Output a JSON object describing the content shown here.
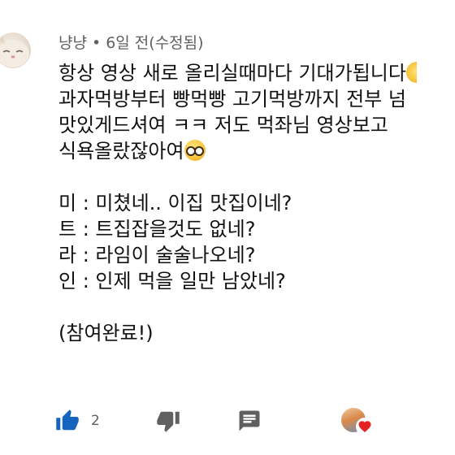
{
  "comment": {
    "author": "냥냥",
    "separator": "•",
    "time": "6일 전(수정됨)",
    "lines": [
      "항상 영상 새로 올리실때마다 기대가됩니다",
      "과자먹방부터 빵먹빵 고기먹방까지 전부 넘",
      "맛있게드셔여 ㅋㅋ 저도 먹좌님 영상보고",
      "식욕올랐잖아여",
      "",
      "미 : 미쳤네.. 이집 맛집이네?",
      "트 : 트집잡을것도 없네?",
      "라 : 라임이 술술나오네?",
      "인 : 인제 먹을 일만 남았네?",
      "",
      "(참여완료!)"
    ],
    "icons": {
      "line1_end": "smiling-face-emoji",
      "line4_end": "nerd-face-emoji"
    }
  },
  "actions": {
    "like_count": "2",
    "like_icon": "thumbs-up-icon",
    "dislike_icon": "thumbs-down-icon",
    "reply_icon": "reply-icon",
    "creator_heart_icon": "creator-heart-icon"
  },
  "colors": {
    "like": "#1565c0",
    "icon_gray": "#606060",
    "heart": "#e52222",
    "meta_text": "#606060",
    "text": "#111111"
  }
}
